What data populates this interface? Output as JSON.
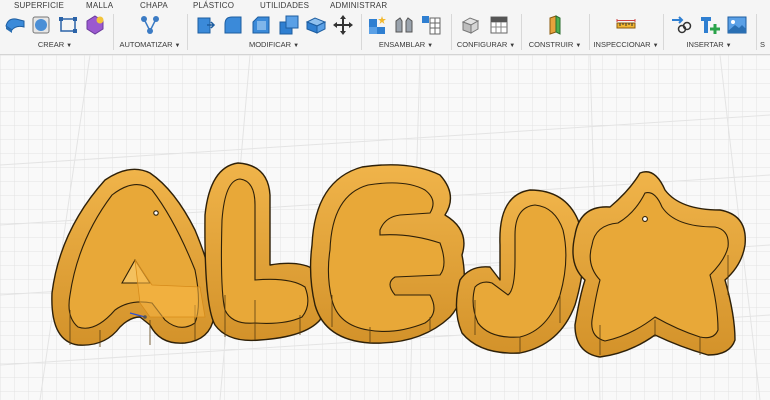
{
  "tabs": [
    "SUPERFICIE",
    "MALLA",
    "CHAPA",
    "PLÁSTICO",
    "UTILIDADES",
    "ADMINISTRAR"
  ],
  "groups": {
    "crear": "CREAR",
    "automatizar": "AUTOMATIZAR",
    "modificar": "MODIFICAR",
    "ensamblar": "ENSAMBLAR",
    "configurar": "CONFIGURAR",
    "construir": "CONSTRUIR",
    "inspeccionar": "INSPECCIONAR",
    "insertar": "INSERTAR",
    "seleccionar_partial": "S"
  },
  "colors": {
    "toolbar_bg": "#f5f5f5",
    "model_fill": "#e8a838",
    "model_dark": "#c7861f",
    "model_outline": "#3a2a10",
    "grid": "#dcdcdc",
    "accent_blue": "#2f7fd1"
  },
  "icons": [
    "extrude-icon",
    "sphere-icon",
    "sketch-icon",
    "form-icon",
    "automate-icon",
    "press-pull-icon",
    "fillet-icon",
    "chamfer-icon",
    "shell-icon",
    "combine-icon",
    "move-icon",
    "new-component-icon",
    "joint-icon",
    "table-icon",
    "parameters-icon",
    "sheet-icon",
    "plane-icon",
    "measure-icon",
    "insert-link-icon",
    "insert-derive-icon",
    "image-icon"
  ]
}
